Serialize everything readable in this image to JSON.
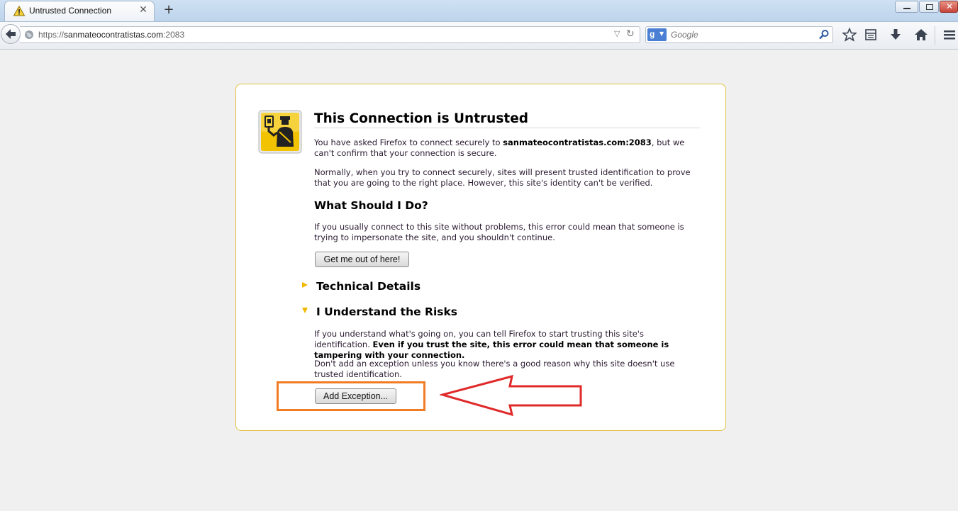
{
  "browser": {
    "tab": {
      "title": "Untrusted Connection"
    },
    "new_tab_label": "+",
    "url": {
      "prefix": "https://",
      "host": "sanmateocontratistas.com",
      "port": ":2083"
    },
    "search": {
      "placeholder": "Google",
      "engine_letter": "g"
    }
  },
  "error_page": {
    "title": "This Connection is Untrusted",
    "intro": {
      "before": "You have asked Firefox to connect securely to ",
      "site": "sanmateocontratistas.com:2083",
      "after": ", but we can't confirm that your connection is secure."
    },
    "normally": "Normally, when you try to connect securely, sites will present trusted identification to prove that you are going to the right place. However, this site's identity can't be verified.",
    "what_heading": "What Should I Do?",
    "what_text": "If you usually connect to this site without problems, this error could mean that someone is trying to impersonate the site, and you shouldn't continue.",
    "get_out_button": "Get me out of here!",
    "technical_heading": "Technical Details",
    "risks_heading": "I Understand the Risks",
    "risks_text": {
      "normal": "If you understand what's going on, you can tell Firefox to start trusting this site's identification. ",
      "bold": "Even if you trust the site, this error could mean that someone is tampering with your connection."
    },
    "dont_add": "Don't add an exception unless you know there's a good reason why this site doesn't use trusted identification.",
    "add_exception_button": "Add Exception..."
  },
  "colors": {
    "highlight_box": "#f07c24",
    "arrow": "#e02a2a",
    "box_border": "#e2c244",
    "expander": "#f2b800"
  }
}
